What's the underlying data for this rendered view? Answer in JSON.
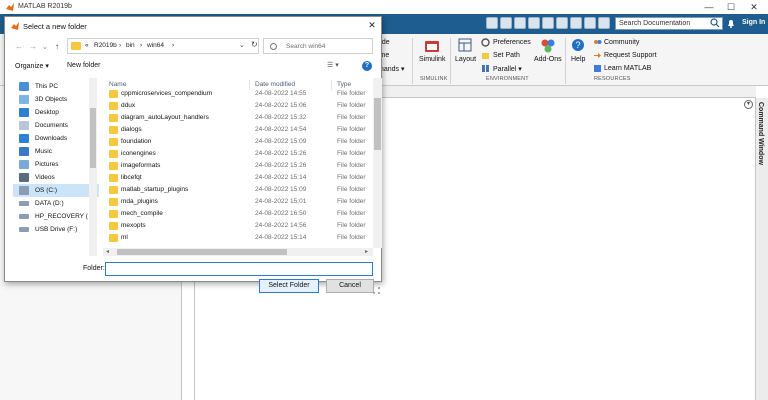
{
  "matlab": {
    "title": "MATLAB R2019b",
    "search_placeholder": "Search Documentation",
    "signin": "Sign In",
    "ribbon": {
      "code_partial": "ode",
      "ime_partial": "ime",
      "commands_partial": "mands ▾",
      "simulink": "Simulink",
      "layout": "Layout",
      "preferences": "Preferences",
      "set_path": "Set Path",
      "parallel": "Parallel ▾",
      "add_ons": "Add-Ons",
      "help": "Help",
      "community": "Community",
      "request_support": "Request Support",
      "learn_matlab": "Learn MATLAB",
      "sections": {
        "simulink": "SIMULINK",
        "environment": "ENVIRONMENT",
        "resources": "RESOURCES"
      }
    },
    "command_window_label": "Command Window",
    "minimize": "—",
    "maximize": "☐",
    "close": "✕"
  },
  "dialog": {
    "title": "Select a new folder",
    "close": "✕",
    "address": {
      "crumbs": [
        "«",
        "R2019b",
        "›",
        "bin",
        "›",
        "win64",
        "›"
      ],
      "dropdown": "⌄",
      "refresh": "↻"
    },
    "search_placeholder": "Search win64",
    "toolbar": {
      "organize": "Organize ▾",
      "new_folder": "New folder",
      "view": "☰ ▾",
      "help": "?"
    },
    "nav": [
      {
        "label": "This PC",
        "icon": "pc-icon"
      },
      {
        "label": "3D Objects",
        "icon": "3d-objects-icon"
      },
      {
        "label": "Desktop",
        "icon": "desktop-icon"
      },
      {
        "label": "Documents",
        "icon": "documents-icon"
      },
      {
        "label": "Downloads",
        "icon": "downloads-icon"
      },
      {
        "label": "Music",
        "icon": "music-icon"
      },
      {
        "label": "Pictures",
        "icon": "pictures-icon"
      },
      {
        "label": "Videos",
        "icon": "videos-icon"
      },
      {
        "label": "OS (C:)",
        "icon": "drive-icon",
        "selected": true
      },
      {
        "label": "DATA (D:)",
        "icon": "drive-icon"
      },
      {
        "label": "HP_RECOVERY (",
        "icon": "drive-icon"
      },
      {
        "label": "USB Drive (F:)",
        "icon": "usb-drive-icon"
      }
    ],
    "columns": {
      "name": "Name",
      "date": "Date modified",
      "type": "Type"
    },
    "files": [
      {
        "name": "cppmicroservices_compendium",
        "date": "24-08-2022 14:55",
        "type": "File folder"
      },
      {
        "name": "ddux",
        "date": "24-08-2022 15:06",
        "type": "File folder"
      },
      {
        "name": "diagram_autoLayout_handlers",
        "date": "24-08-2022 15:32",
        "type": "File folder"
      },
      {
        "name": "dialogs",
        "date": "24-08-2022 14:54",
        "type": "File folder"
      },
      {
        "name": "foundation",
        "date": "24-08-2022 15:09",
        "type": "File folder"
      },
      {
        "name": "iconengines",
        "date": "24-08-2022 15:26",
        "type": "File folder"
      },
      {
        "name": "imageformats",
        "date": "24-08-2022 15:26",
        "type": "File folder"
      },
      {
        "name": "libcefqt",
        "date": "24-08-2022 15:14",
        "type": "File folder"
      },
      {
        "name": "matlab_startup_plugins",
        "date": "24-08-2022 15:09",
        "type": "File folder"
      },
      {
        "name": "mda_plugins",
        "date": "24-08-2022 15:01",
        "type": "File folder"
      },
      {
        "name": "mech_compile",
        "date": "24-08-2022 16:50",
        "type": "File folder"
      },
      {
        "name": "mexopts",
        "date": "24-08-2022 14:56",
        "type": "File folder"
      },
      {
        "name": "ml",
        "date": "24-08-2022 15:14",
        "type": "File folder"
      }
    ],
    "folder_label": "Folder:",
    "folder_value": "",
    "select_button": "Select Folder",
    "cancel_button": "Cancel"
  }
}
